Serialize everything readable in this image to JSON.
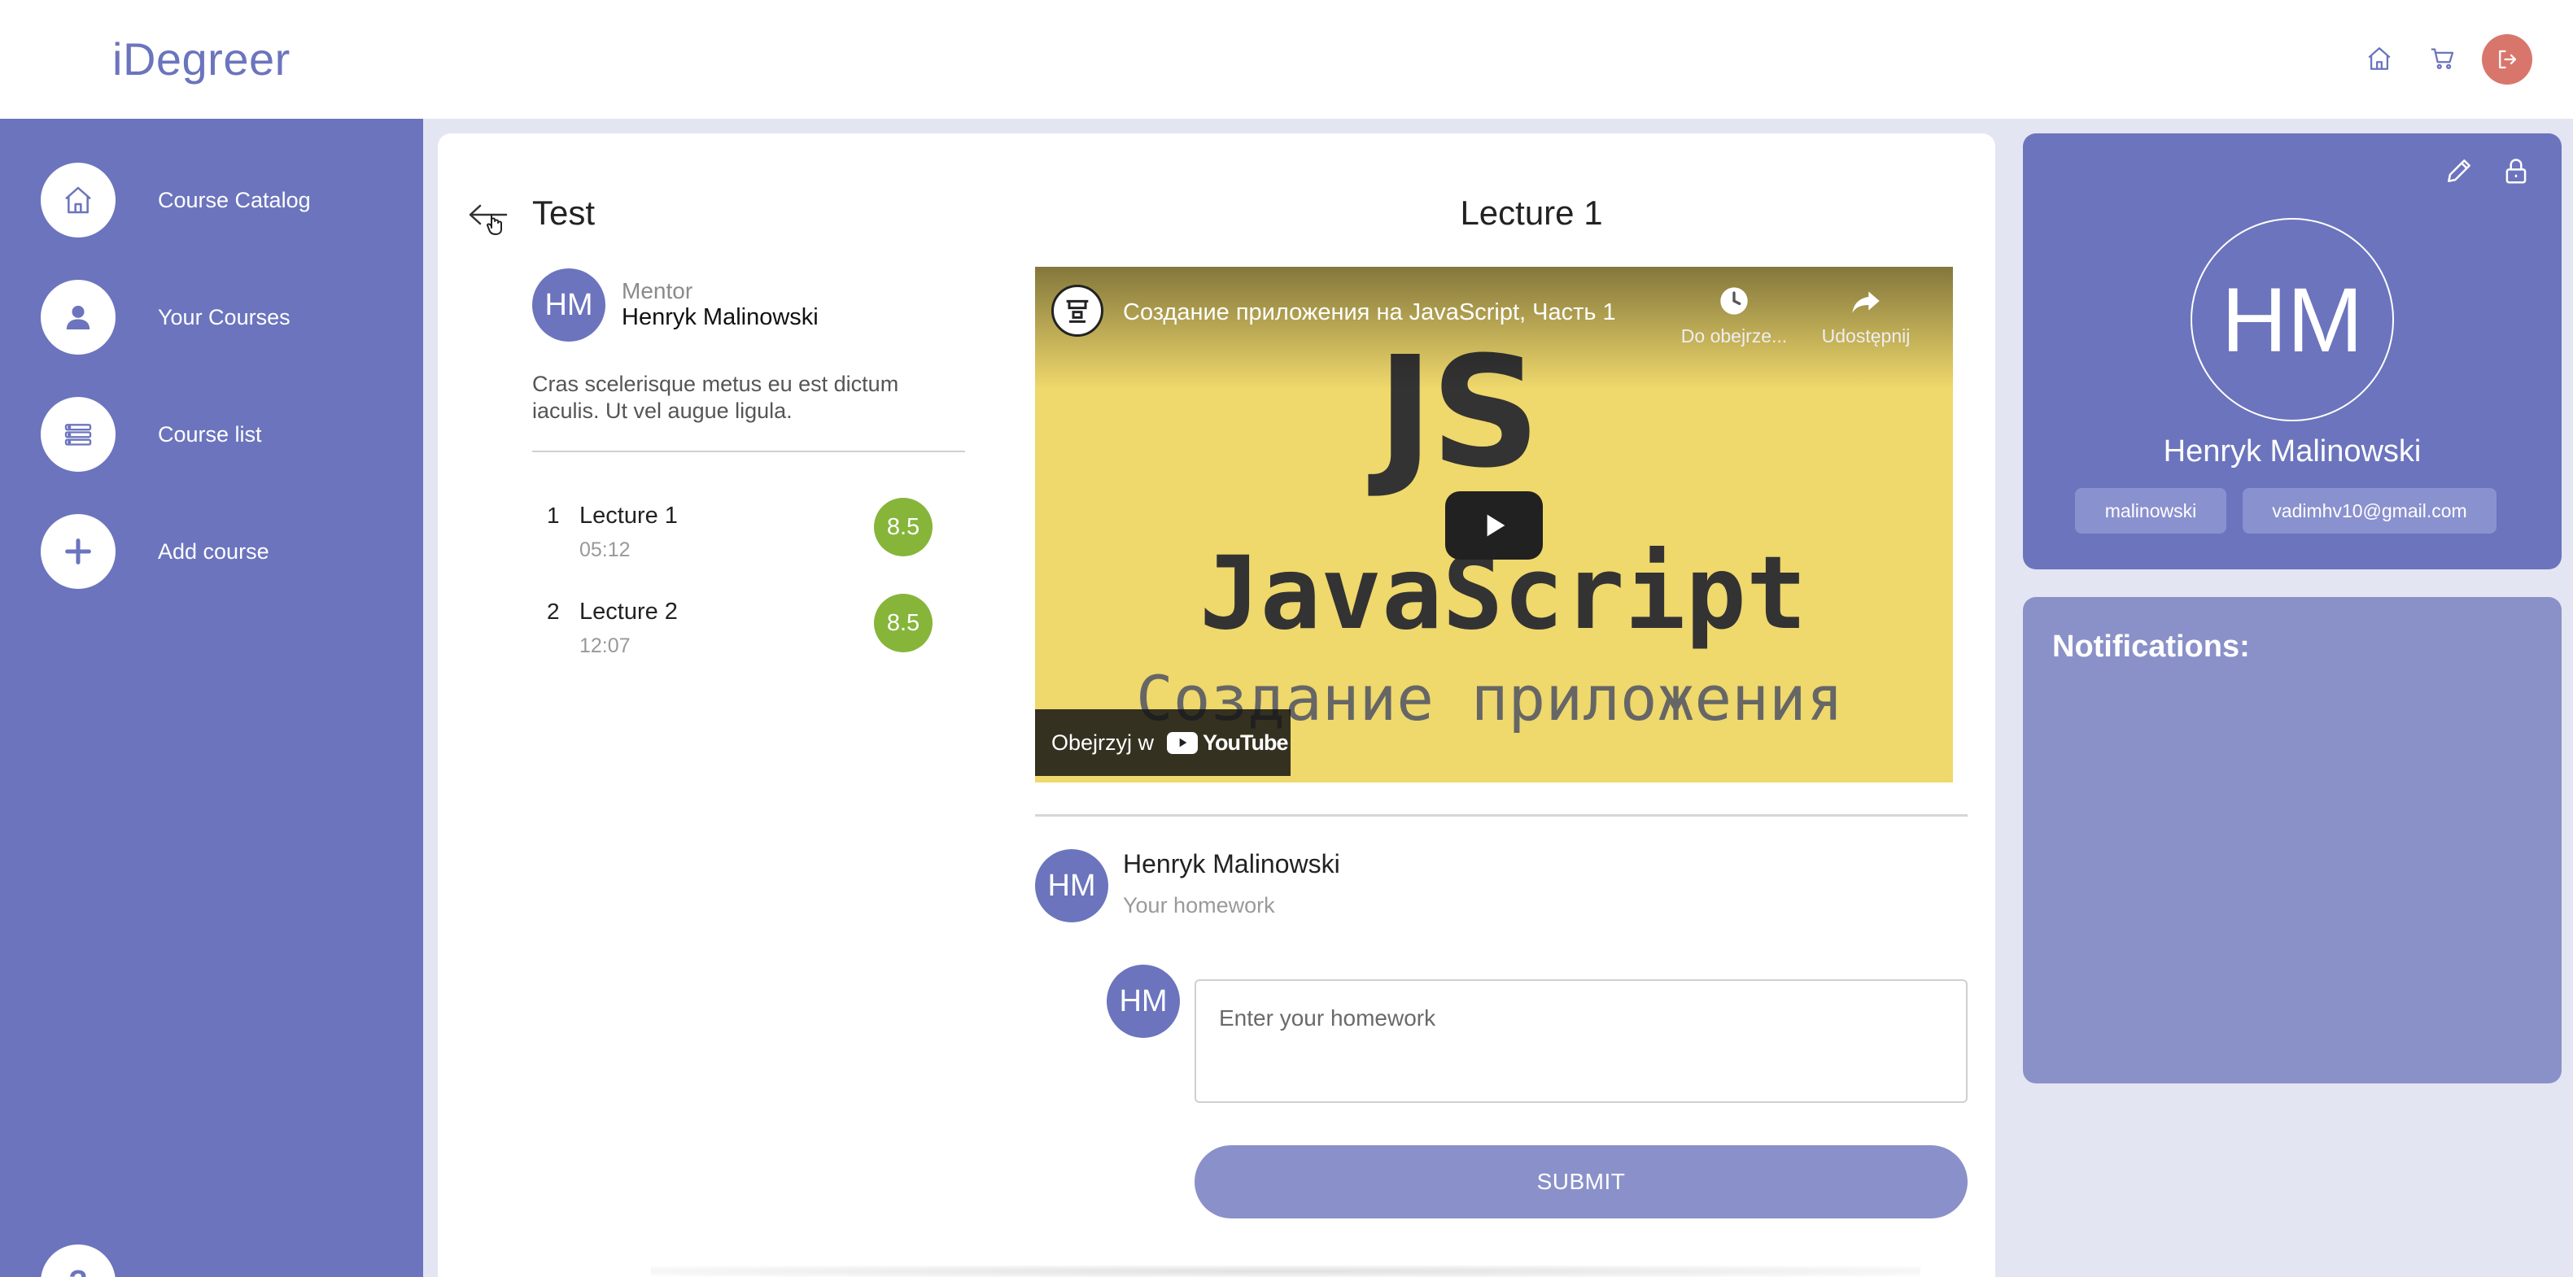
{
  "header": {
    "logo": "iDegreer",
    "icons": [
      "home-icon",
      "cart-icon",
      "logout-icon"
    ]
  },
  "sidebar": {
    "items": [
      {
        "label": "Course Catalog",
        "icon": "home-icon"
      },
      {
        "label": "Your Courses",
        "icon": "user-icon"
      },
      {
        "label": "Course list",
        "icon": "list-icon"
      },
      {
        "label": "Add course",
        "icon": "plus-icon"
      }
    ],
    "help_label": "?"
  },
  "course": {
    "title": "Test",
    "mentor_initials": "HM",
    "mentor_role": "Mentor",
    "mentor_name": "Henryk Malinowski",
    "description": "Cras scelerisque metus eu est dictum iaculis. Ut vel augue ligula.",
    "lectures": [
      {
        "number": "1",
        "title": "Lecture 1",
        "duration": "05:12",
        "score": "8.5"
      },
      {
        "number": "2",
        "title": "Lecture 2",
        "duration": "12:07",
        "score": "8.5"
      }
    ]
  },
  "lecture": {
    "title": "Lecture 1",
    "video": {
      "title": "Создание приложения на JavaScript, Часть 1",
      "watch_later": "Do obejrze...",
      "share": "Udostępnij",
      "big_text": "JS",
      "word": "JavaScript",
      "subtitle": "Создание приложения",
      "watch_on": "Obejrzyj w",
      "platform": "YouTube"
    },
    "comment": {
      "initials": "HM",
      "author": "Henryk Malinowski",
      "text": "Your homework"
    },
    "homework": {
      "initials": "HM",
      "placeholder": "Enter your homework",
      "value": "",
      "submit_label": "SUBMIT"
    }
  },
  "profile": {
    "initials": "HM",
    "name": "Henryk Malinowski",
    "username": "malinowski",
    "email": "vadimhv10@gmail.com"
  },
  "notifications": {
    "title": "Notifications:"
  },
  "colors": {
    "primary": "#6b74bd",
    "score": "#86b53a",
    "logout": "#d9766c",
    "notifications_bg": "#8a91c8",
    "submit": "#8a90c9"
  }
}
